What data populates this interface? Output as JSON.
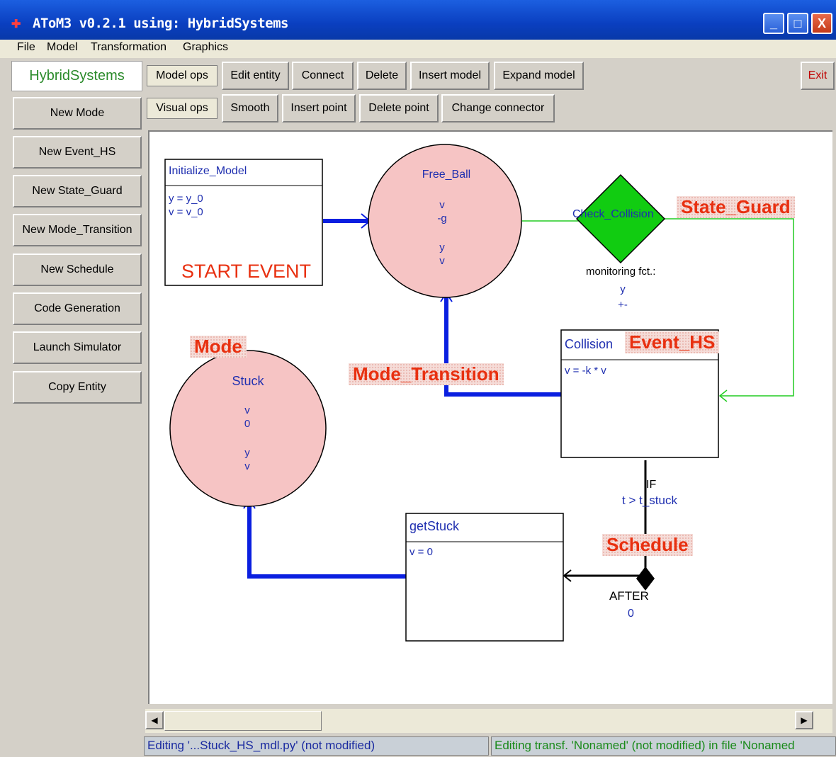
{
  "window": {
    "title": "AToM3 v0.2.1 using: HybridSystems",
    "minimize": "_",
    "maximize": "□",
    "close": "X"
  },
  "menu": [
    "File",
    "Model",
    "Transformation",
    "Graphics"
  ],
  "left_panel": {
    "title": "HybridSystems",
    "buttons": [
      "New Mode",
      "New Event_HS",
      "New State_Guard",
      "New Mode_Transition",
      "New Schedule",
      "Code Generation",
      "Launch Simulator",
      "Copy Entity"
    ]
  },
  "toolbar_model": {
    "label": "Model ops",
    "buttons": [
      "Edit entity",
      "Connect",
      "Delete",
      "Insert model",
      "Expand model"
    ],
    "exit": "Exit"
  },
  "toolbar_visual": {
    "label": "Visual ops",
    "buttons": [
      "Smooth",
      "Insert point",
      "Delete point",
      "Change connector"
    ]
  },
  "diagram": {
    "initialize": {
      "name": "Initialize_Model",
      "lines": [
        "y = y_0",
        "v = v_0"
      ],
      "label": "START EVENT"
    },
    "free_ball": {
      "name": "Free_Ball",
      "lines": [
        "v",
        "-g",
        "",
        "y",
        "v"
      ]
    },
    "check_collision": {
      "name": "Check_Collision",
      "monitor_label": "monitoring fct.:",
      "monitor_lines": [
        "y",
        "+-"
      ]
    },
    "collision": {
      "name": "Collision",
      "lines": [
        "v = -k * v"
      ]
    },
    "stuck": {
      "name": "Stuck",
      "lines": [
        "v",
        "0",
        "",
        "y",
        "v"
      ]
    },
    "get_stuck": {
      "name": "getStuck",
      "lines": [
        "v = 0"
      ]
    },
    "schedule_if": "IF",
    "schedule_cond": "t > t_stuck",
    "after_label": "AFTER",
    "after_value": "0",
    "type_labels": {
      "mode": "Mode",
      "mode_transition": "Mode_Transition",
      "state_guard": "State_Guard",
      "event_hs": "Event_HS",
      "schedule": "Schedule"
    }
  },
  "status": {
    "left": "Editing '...Stuck_HS_mdl.py' (not modified)",
    "right": "Editing transf. 'Nonamed' (not modified) in file 'Nonamed"
  },
  "colors": {
    "mode_fill": "#f6c4c4",
    "guard_fill": "#11cc11",
    "connector_blue": "#0a1fe0",
    "connector_green": "#22cc22",
    "label_red": "#e83010"
  }
}
